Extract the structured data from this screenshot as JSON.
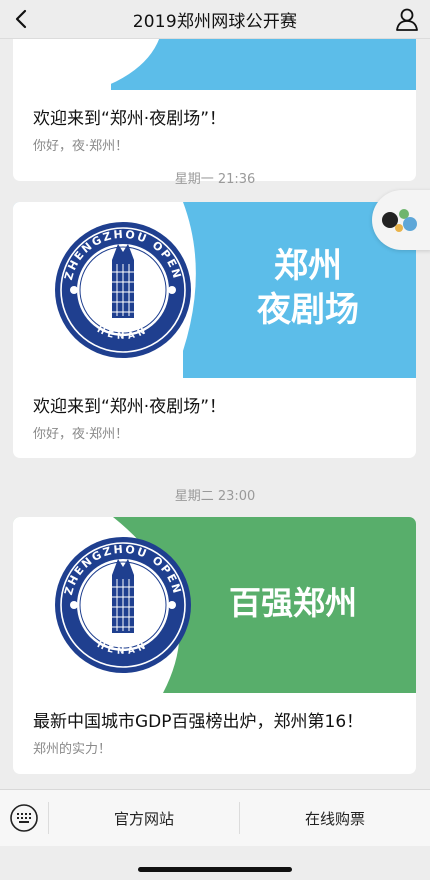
{
  "header": {
    "title": "2019郑州网球公开赛"
  },
  "messages": [
    {
      "title": "欢迎来到“郑州·夜剧场”！",
      "subtitle": "你好，夜·郑州！"
    },
    {
      "timestamp": "星期一 21:36",
      "cover_text_line1": "郑州",
      "cover_text_line2": "夜剧场",
      "title": "欢迎来到“郑州·夜剧场”！",
      "subtitle": "你好，夜·郑州！"
    },
    {
      "timestamp": "星期二 23:00",
      "cover_text": "百强郑州",
      "title": "最新中国城市GDP百强榜出炉，郑州第16！",
      "subtitle": "郑州的实力！"
    }
  ],
  "logo": {
    "text_top": "ZHENGZHOU OPEN",
    "text_bottom": "HENAN"
  },
  "bottom_menu": {
    "item1": "官方网站",
    "item2": "在线购票"
  },
  "colors": {
    "cover_blue": "#5cbde9",
    "cover_green": "#58ae6b",
    "logo_navy": "#1f3f8f"
  }
}
